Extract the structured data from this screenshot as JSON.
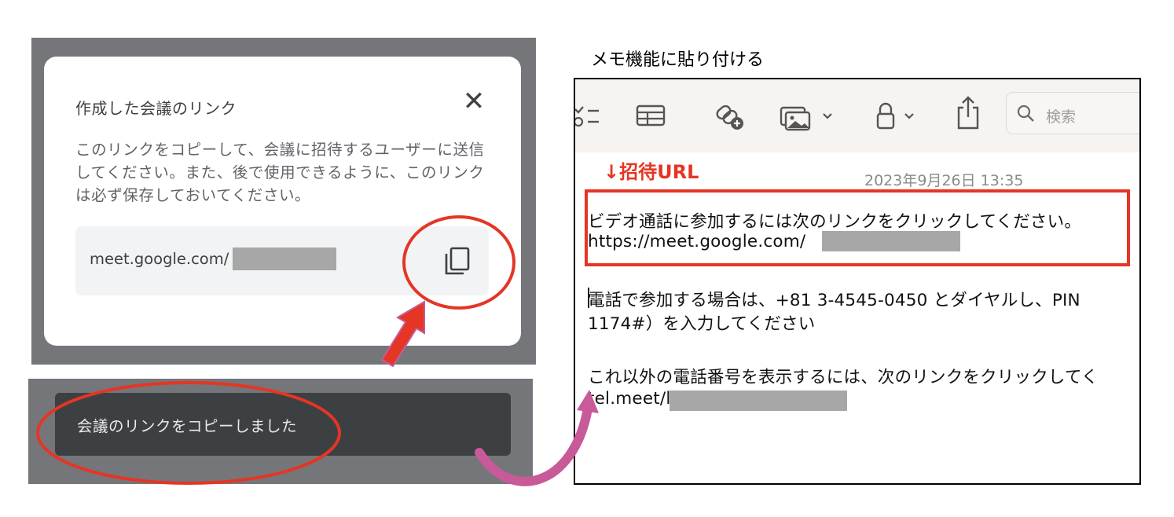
{
  "meet_dialog": {
    "title": "作成した会議のリンク",
    "body": "このリンクをコピーして、会議に招待するユーザーに送信してください。また、後で使用できるように、このリンクは必ず保存しておいてください。",
    "link_text": "meet.google.com/",
    "close_icon": "close-icon",
    "copy_icon": "copy-icon"
  },
  "toast": {
    "message": "会議のリンクをコピーしました"
  },
  "notes": {
    "caption": "メモ機能に貼り付ける",
    "search_placeholder": "検索",
    "invite_label": "↓招待URL",
    "date": "2023年9月26日 13:35",
    "lines": [
      "ビデオ通話に参加するには次のリンクをクリックしてください。",
      "https://meet.google.com/",
      "電話で参加する場合は、+81 3-4545-0450 とダイヤルし、PIN",
      "1174#）を入力してください",
      "これ以外の電話番号を表示するには、次のリンクをクリックしてく",
      "tel.meet/l"
    ],
    "toolbar_icons": [
      "checklist-icon",
      "table-icon",
      "link-add-icon",
      "media-icon",
      "lock-icon",
      "share-icon",
      "search-icon"
    ]
  },
  "annotation_colors": {
    "red": "#e53524",
    "pink_arrow": "#c85a9a"
  }
}
